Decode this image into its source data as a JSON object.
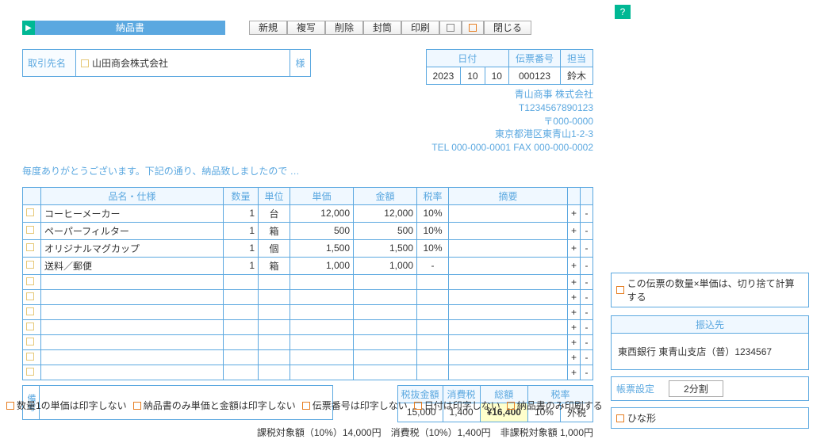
{
  "title": "納品書",
  "toolbar": {
    "new": "新規",
    "copy": "複写",
    "delete": "削除",
    "envelope": "封筒",
    "print": "印刷",
    "close": "閉じる"
  },
  "customer": {
    "label": "取引先名",
    "name": "山田商会株式会社",
    "honorific": "様"
  },
  "meta": {
    "date_h": "日付",
    "slip_h": "伝票番号",
    "staff_h": "担当",
    "y": "2023",
    "m": "10",
    "d": "10",
    "slip": "000123",
    "staff": "鈴木"
  },
  "company": {
    "name": "青山商事 株式会社",
    "reg": "T1234567890123",
    "zip": "〒000-0000",
    "addr": "東京都港区東青山1-2-3",
    "tel": "TEL 000-000-0001 FAX 000-000-0002"
  },
  "greeting": "毎度ありがとうございます。下記の通り、納品致しましたので …",
  "cols": {
    "name": "品名・仕様",
    "qty": "数量",
    "unit": "単位",
    "price": "単価",
    "amt": "金額",
    "tax": "税率",
    "note": "摘要"
  },
  "rows": [
    {
      "name": "コーヒーメーカー",
      "qty": "1",
      "unit": "台",
      "price": "12,000",
      "amt": "12,000",
      "tax": "10%"
    },
    {
      "name": "ペーパーフィルター",
      "qty": "1",
      "unit": "箱",
      "price": "500",
      "amt": "500",
      "tax": "10%"
    },
    {
      "name": "オリジナルマグカップ",
      "qty": "1",
      "unit": "個",
      "price": "1,500",
      "amt": "1,500",
      "tax": "10%"
    },
    {
      "name": "送料／郵便",
      "qty": "1",
      "unit": "箱",
      "price": "1,000",
      "amt": "1,000",
      "tax": "-"
    }
  ],
  "remarks_label": "備考",
  "totals": {
    "sub_h": "税抜金額",
    "ctax_h": "消費税",
    "total_h": "総額",
    "rate_h": "税率",
    "sub": "15,000",
    "ctax": "1,400",
    "total": "¥16,400",
    "rate": "10%",
    "type": "外税"
  },
  "tax_summary": "課税対象額（10%）14,000円　消費税（10%）1,400円　非課税対象額 1,000円",
  "foot": [
    "数量1の単価は印字しない",
    "納品書のみ単価と金額は印字しない",
    "伝票番号は印字しない",
    "日付は印字しない",
    "納品書のみ印刷する"
  ],
  "side": {
    "calc_note": "この伝票の数量×単価は、切り捨て計算する",
    "bank_h": "振込先",
    "bank": "東西銀行 東青山支店（普）1234567",
    "form_label": "帳票設定",
    "form_val": "2分割",
    "tmpl": "ひな形",
    "help": "?"
  }
}
